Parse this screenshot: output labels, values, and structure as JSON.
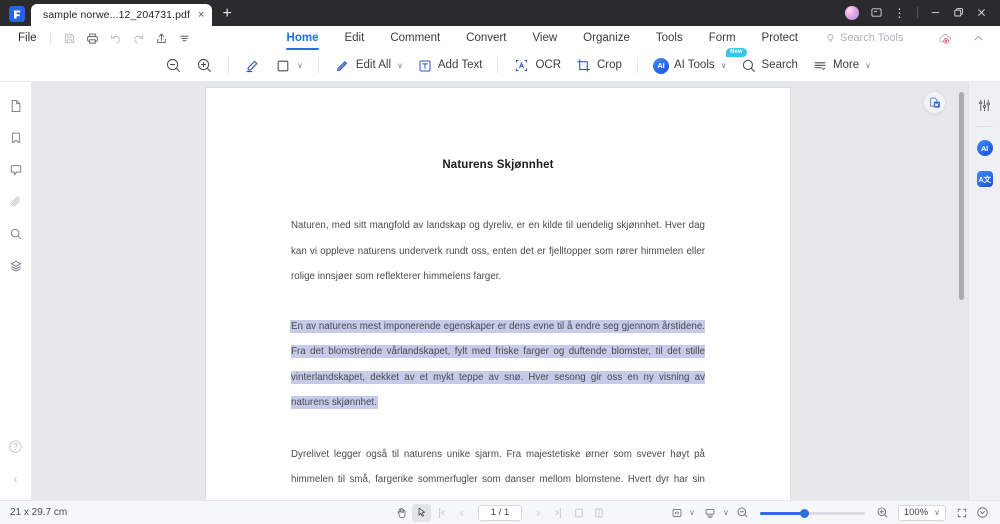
{
  "window": {
    "tab_title": "sample  norwe...12_204731.pdf",
    "tab_close_label": "×",
    "new_tab_label": "+",
    "minimize_label": "—",
    "maximize_label": "❐",
    "close_label": "✕",
    "kebab_label": "⋮"
  },
  "menubar": {
    "file_label": "File",
    "quick_icons": [
      "save-icon",
      "print-icon",
      "undo-icon",
      "redo-icon",
      "share-icon",
      "customize-icon"
    ],
    "tabs": [
      {
        "label": "Home",
        "active": true
      },
      {
        "label": "Edit",
        "active": false
      },
      {
        "label": "Comment",
        "active": false
      },
      {
        "label": "Convert",
        "active": false
      },
      {
        "label": "View",
        "active": false
      },
      {
        "label": "Organize",
        "active": false
      },
      {
        "label": "Tools",
        "active": false
      },
      {
        "label": "Form",
        "active": false
      },
      {
        "label": "Protect",
        "active": false
      }
    ],
    "search_tools_label": "Search Tools",
    "cloud_badge": "cloud-sync-error-icon",
    "collapse_label": "collapse-ribbon-icon"
  },
  "toolbar": {
    "zoom_out_label": "zoom-out-icon",
    "zoom_in_label": "zoom-in-icon",
    "highlight_label": "highlighter-icon",
    "shape_label": "rectangle-icon",
    "edit_all_label": "Edit All",
    "add_text_label": "Add Text",
    "ocr_label": "OCR",
    "crop_label": "Crop",
    "ai_tools_label": "AI Tools",
    "ai_tools_badge": "New",
    "ai_tools_initials": "AI",
    "search_label": "Search",
    "more_label": "More",
    "chevron": "∨"
  },
  "left_sidebar": {
    "items": [
      {
        "name": "thumbnails-icon"
      },
      {
        "name": "bookmarks-icon"
      },
      {
        "name": "comments-icon"
      },
      {
        "name": "attachments-icon"
      },
      {
        "name": "search-panel-icon"
      },
      {
        "name": "layers-icon"
      }
    ],
    "help_label": "?",
    "collapse_label": "‹"
  },
  "right_sidebar": {
    "properties_label": "properties-sliders-icon",
    "ai_label": "AI",
    "translate_label": "A文"
  },
  "document": {
    "title": "Naturens Skjønnhet",
    "paragraphs": [
      {
        "highlighted": false,
        "text": "Naturen, med sitt mangfold av landskap og dyreliv, er en kilde til uendelig skjønnhet. Hver dag kan vi oppleve naturens underverk rundt oss, enten det er fjelltopper som rører himmelen eller rolige innsjøer som reflekterer himmelens farger."
      },
      {
        "highlighted": true,
        "text": "En av naturens mest imponerende egenskaper er dens evne til å endre seg gjennom årstidene. Fra det blomstrende vårlandskapet, fylt med friske farger og duftende blomster, til det stille vinterlandskapet, dekket av et mykt teppe av snø. Hver sesong gir oss en ny visning av naturens skjønnhet."
      },
      {
        "highlighted": false,
        "text": "Dyrelivet legger også til naturens unike sjarm. Fra majestetiske ørner som svever høyt på himmelen til små, fargerike sommerfugler som danser mellom blomstene. Hvert dyr har sin rolle i naturens symfoni, og deres tilstedeværelse forsterker den naturlige skjønnheten."
      }
    ],
    "float_button_label": "convert-to-word-icon",
    "highlight_color": "#c5cbe8"
  },
  "statusbar": {
    "page_dimensions": "21 x 29.7 cm",
    "hand_tool_label": "hand-tool-icon",
    "select_tool_label": "select-tool-icon",
    "first_page_label": "|‹",
    "prev_page_label": "‹",
    "page_value": "1 / 1",
    "next_page_label": "›",
    "last_page_label": "›|",
    "single_page_label": "single-page-view-icon",
    "facing_page_label": "facing-page-view-icon",
    "page_fit_label": "page-fit-icon",
    "page_layout_label": "page-layout-icon",
    "zoom_out_label": "zoom-out-icon",
    "zoom_in_label": "zoom-in-icon",
    "zoom_value": "100%",
    "fullscreen_label": "fullscreen-icon",
    "more_options_label": "more-options-icon",
    "zoom_percent": 42
  },
  "colors": {
    "accent": "#1f6fe5",
    "titlebar_bg": "#2b2b2e",
    "viewport_bg": "#e7e8ec",
    "selection": "#c5cbe8"
  }
}
